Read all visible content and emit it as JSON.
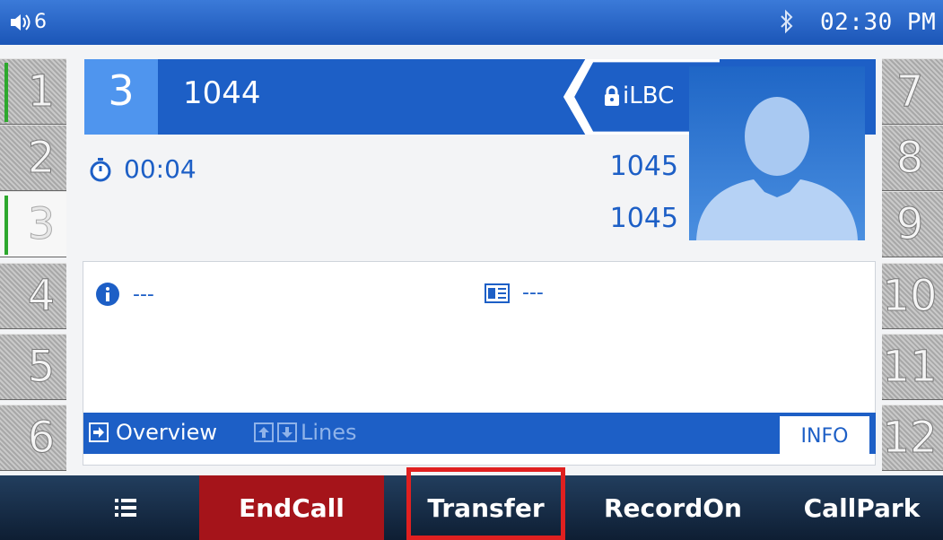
{
  "status_bar": {
    "volume_level": "6",
    "time": "02:30 PM"
  },
  "line_keys": {
    "left": [
      "1",
      "2",
      "3",
      "4",
      "5",
      "6"
    ],
    "right": [
      "7",
      "8",
      "9",
      "10",
      "11",
      "12"
    ],
    "active_line": "3"
  },
  "call": {
    "line_number": "3",
    "number": "1044",
    "codec": "iLBC",
    "duration": "00:04",
    "remote_number": "1045",
    "remote_name": "1045"
  },
  "info": {
    "field1": "---",
    "field2": "---"
  },
  "navigation": {
    "overview_label": "Overview",
    "lines_label": "Lines",
    "info_tab": "INFO"
  },
  "softkeys": {
    "endcall": "EndCall",
    "transfer": "Transfer",
    "recordon": "RecordOn",
    "callpark": "CallPark"
  },
  "colors": {
    "accent_blue": "#1d5fc6",
    "end_call_red": "#a5141a",
    "highlight_red": "#e02020",
    "active_line_green": "#2da82d"
  }
}
